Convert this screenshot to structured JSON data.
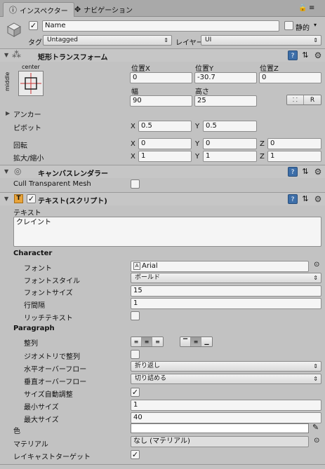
{
  "tabs": [
    {
      "label": "インスペクター",
      "icon": "info-icon"
    },
    {
      "label": "ナビゲーション",
      "icon": "navigation-icon"
    }
  ],
  "object": {
    "name": "Name",
    "static_label": "静的",
    "tag_label": "タグ",
    "tag_value": "Untagged",
    "layer_label": "レイヤー",
    "layer_value": "UI"
  },
  "rect_transform": {
    "title": "矩形トランスフォーム",
    "anchor_h": "center",
    "anchor_v": "middle",
    "pos_x_label": "位置X",
    "pos_x": "0",
    "pos_y_label": "位置Y",
    "pos_y": "-30.7",
    "pos_z_label": "位置Z",
    "pos_z": "0",
    "width_label": "幅",
    "width": "90",
    "height_label": "高さ",
    "height": "25",
    "raw_button": "R",
    "anchors_label": "アンカー",
    "pivot_label": "ピボット",
    "pivot_x": "0.5",
    "pivot_y": "0.5",
    "rotation_label": "回転",
    "rot_x": "0",
    "rot_y": "0",
    "rot_z": "0",
    "scale_label": "拡大/縮小",
    "scale_x": "1",
    "scale_y": "1",
    "scale_z": "1",
    "axis_x": "X",
    "axis_y": "Y",
    "axis_z": "Z"
  },
  "canvas_renderer": {
    "title": "キャンバスレンダラー",
    "cull_label": "Cull Transparent Mesh"
  },
  "text_component": {
    "title": "テキスト(スクリプト)",
    "text_label": "テキスト",
    "text_value": "クレイント",
    "character_header": "Character",
    "font_label": "フォント",
    "font_value": "Arial",
    "font_style_label": "フォントスタイル",
    "font_style_value": "ボールド",
    "font_size_label": "フォントサイズ",
    "font_size_value": "15",
    "line_spacing_label": "行間隔",
    "line_spacing_value": "1",
    "rich_text_label": "リッチテキスト",
    "paragraph_header": "Paragraph",
    "alignment_label": "整列",
    "align_geometry_label": "ジオメトリで整列",
    "h_overflow_label": "水平オーバーフロー",
    "h_overflow_value": "折り返し",
    "v_overflow_label": "垂直オーバーフロー",
    "v_overflow_value": "切り詰める",
    "best_fit_label": "サイズ自動調整",
    "min_size_label": "最小サイズ",
    "min_size_value": "1",
    "max_size_label": "最大サイズ",
    "max_size_value": "40",
    "color_label": "色",
    "color_value": "#ffffff",
    "material_label": "マテリアル",
    "material_value": "なし (マテリアル)",
    "raycast_label": "レイキャストターゲット"
  }
}
